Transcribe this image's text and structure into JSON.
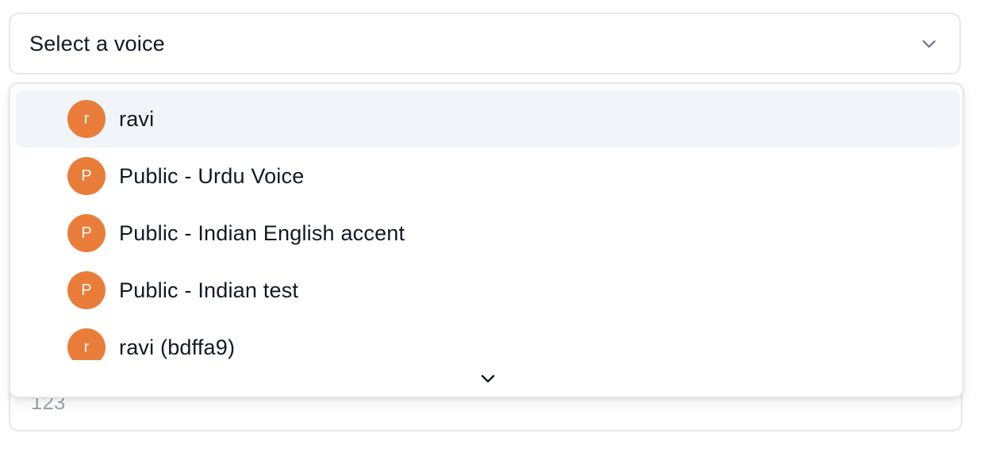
{
  "select": {
    "placeholder": "Select a voice"
  },
  "behind_input": {
    "value": "123"
  },
  "options": [
    {
      "initial": "r",
      "label": "ravi",
      "highlighted": true
    },
    {
      "initial": "P",
      "label": "Public - Urdu Voice",
      "highlighted": false
    },
    {
      "initial": "P",
      "label": "Public - Indian English accent",
      "highlighted": false
    },
    {
      "initial": "P",
      "label": "Public - Indian test",
      "highlighted": false
    },
    {
      "initial": "r",
      "label": "ravi (bdffa9)",
      "highlighted": false
    }
  ],
  "icons": {
    "trigger": "chevron-down-icon",
    "scroll": "chevron-down-icon"
  },
  "colors": {
    "avatar": "#ea7c3a",
    "highlight": "#f1f5f9",
    "border": "#e5e7eb"
  }
}
